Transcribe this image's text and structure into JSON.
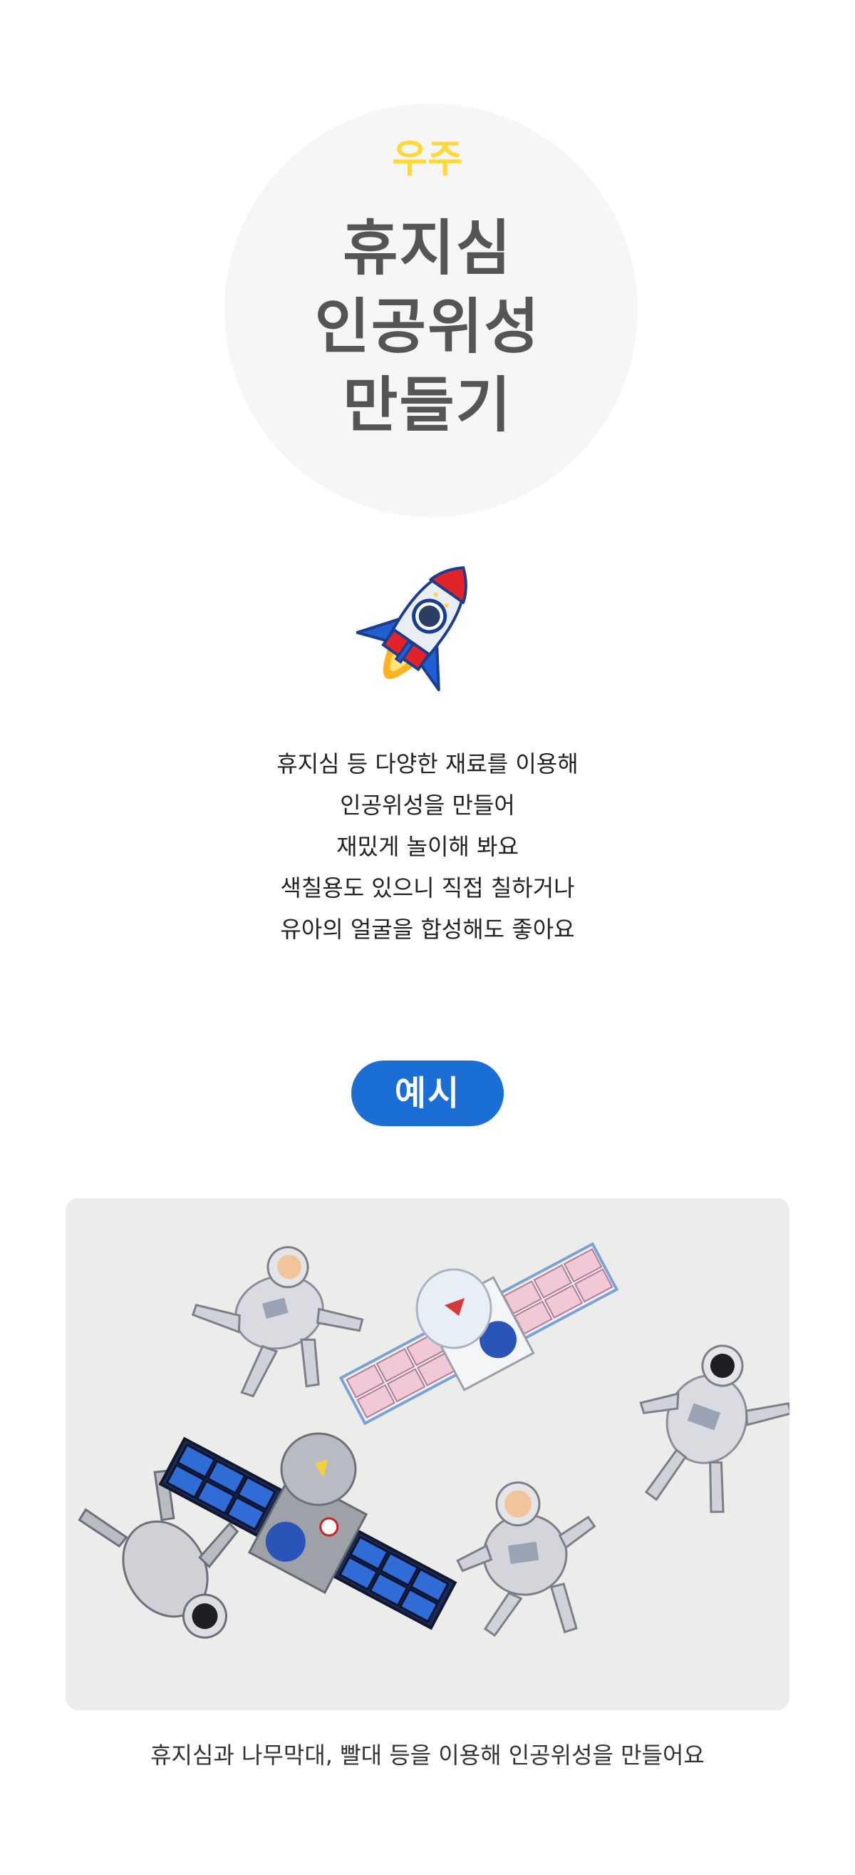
{
  "colors": {
    "accent_yellow": "#ffd93a",
    "title_gray": "#555555",
    "button_blue": "#1b6fd4",
    "circle_bg": "#f6f6f6",
    "text": "#222222"
  },
  "hero": {
    "category": "우주",
    "title_lines": [
      "휴지심",
      "인공위성",
      "만들기"
    ]
  },
  "icon": {
    "name": "rocket-icon"
  },
  "description": {
    "lines": [
      "휴지심 등 다양한 재료를 이용해",
      "인공위성을 만들어",
      "재밌게 놀이해 봐요",
      "색칠용도 있으니 직접 칠하거나",
      "유아의 얼굴을 합성해도 좋아요"
    ]
  },
  "example": {
    "button_label": "예시",
    "image_name": "example-photo",
    "caption": "휴지심과 나무막대, 빨대 등을 이용해 인공위성을 만들어요"
  }
}
